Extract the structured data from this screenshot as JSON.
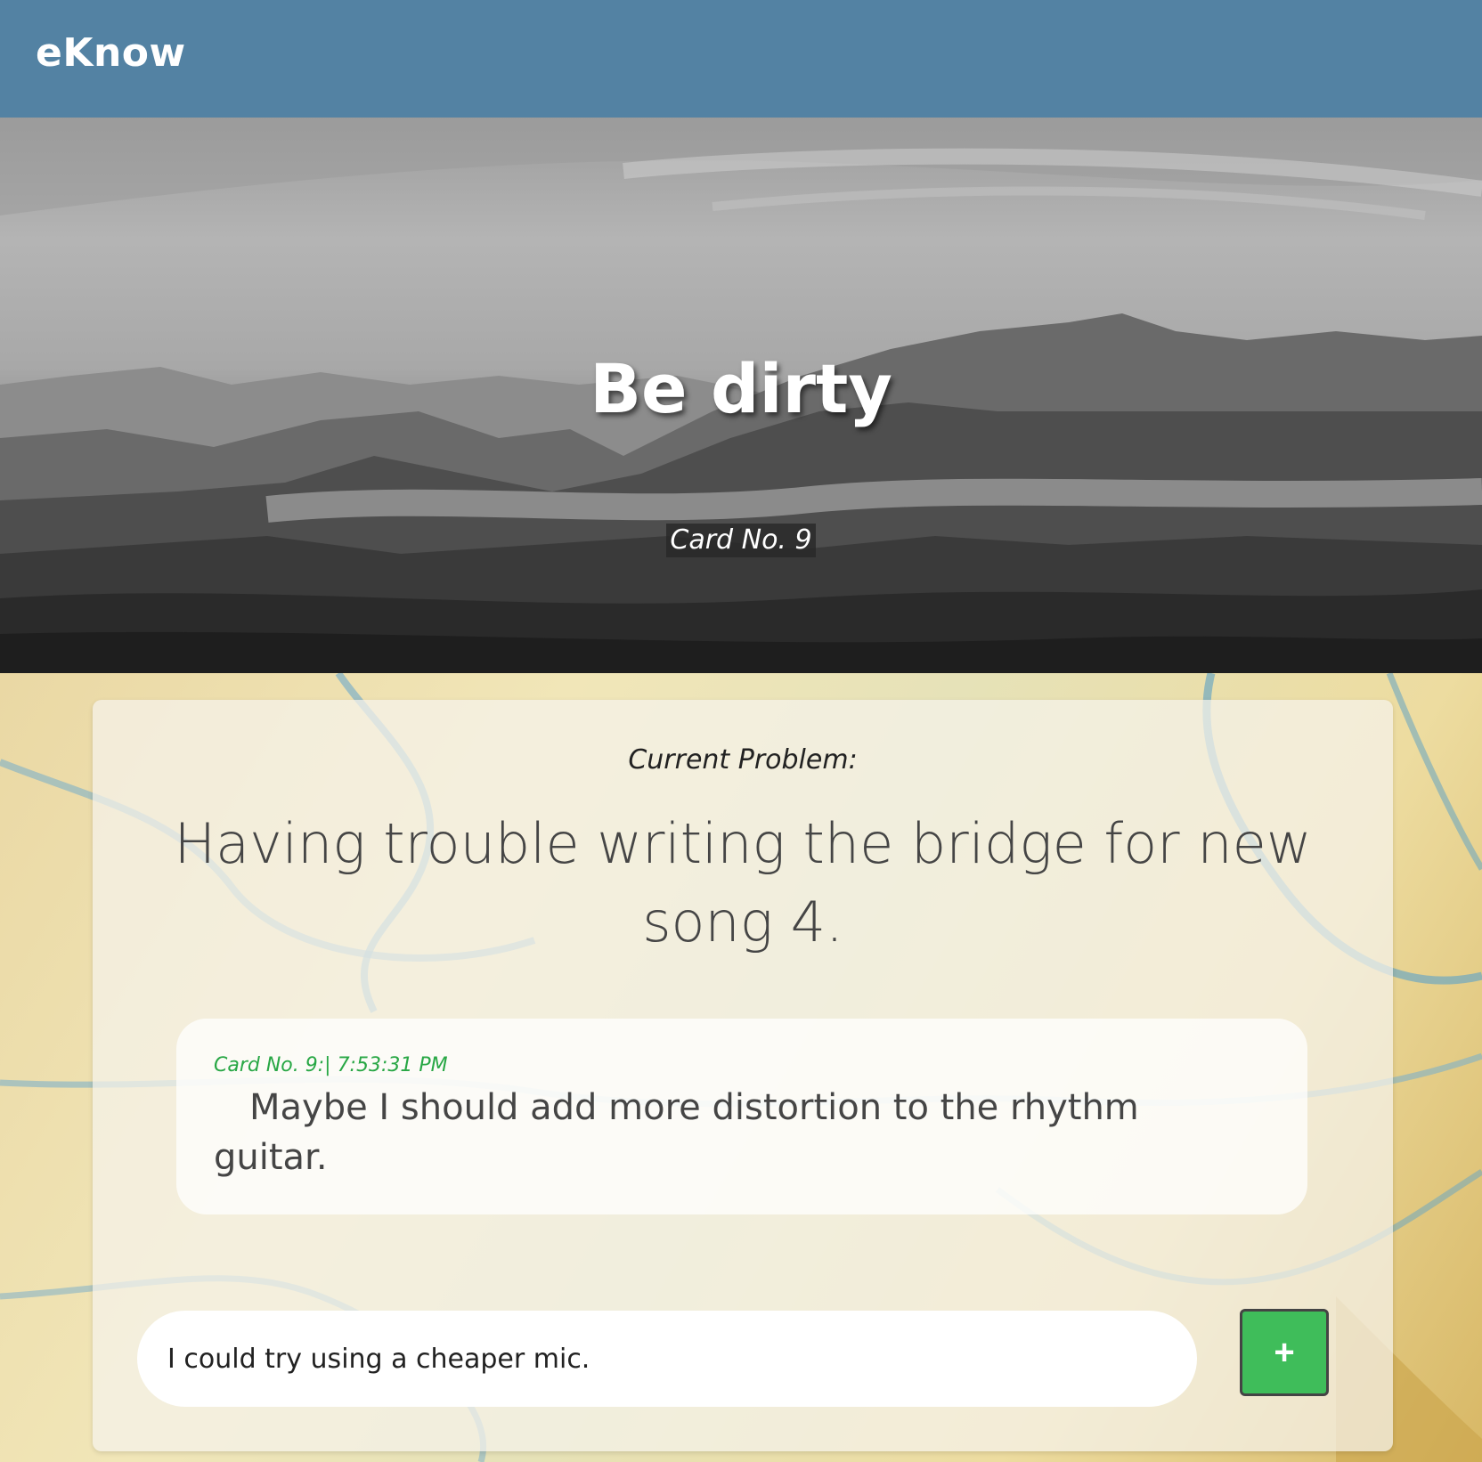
{
  "navbar": {
    "brand": "eKnow"
  },
  "hero": {
    "title": "Be dirty",
    "subtitle": "Card No. 9"
  },
  "card": {
    "problem_label": "Current Problem:",
    "problem_text": "Having trouble writing the bridge for new song 4.",
    "entries": [
      {
        "meta": "Card No. 9:| 7:53:31 PM",
        "text": "Maybe I should add more distortion to the rhythm guitar."
      }
    ],
    "input": {
      "value": "I could try using a cheaper mic."
    },
    "add_button": {
      "label": "+",
      "color": "#3fbd5a"
    }
  },
  "colors": {
    "navbar": "#5382a3",
    "accent": "#28a745"
  }
}
